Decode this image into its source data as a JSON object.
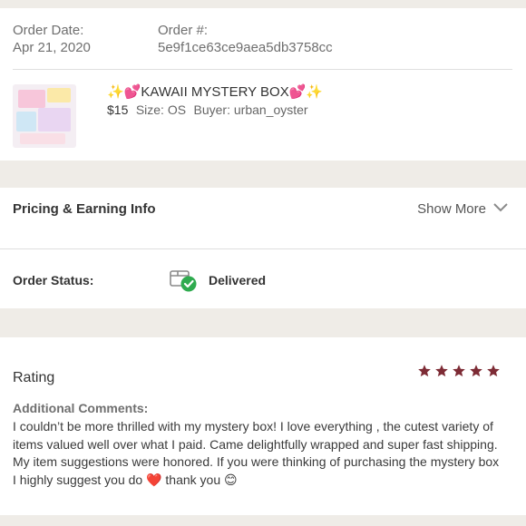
{
  "order": {
    "date_label": "Order Date:",
    "date_value": "Apr 21, 2020",
    "number_label": "Order #:",
    "number_value": "5e9f1ce63ce9aea5db3758cc"
  },
  "item": {
    "title_prefix": "✨💕",
    "title_text": "KAWAII MYSTERY BOX",
    "title_suffix": "💕✨",
    "price": "$15",
    "size": "Size: OS",
    "buyer": "Buyer: urban_oyster"
  },
  "pricing": {
    "title": "Pricing & Earning Info",
    "show_more": "Show More"
  },
  "status": {
    "label": "Order Status:",
    "value": "Delivered",
    "icon": "package-delivered-icon",
    "check_color": "#2fab4f"
  },
  "rating": {
    "title": "Rating",
    "stars": 5,
    "max_stars": 5,
    "star_color": "#7d2b35",
    "comments_label": "Additional Comments:",
    "comments_text": "I couldn’t be more thrilled with my mystery box! I love everything , the cutest variety of items valued well over what I paid. Came delightfully wrapped and super fast shipping. My item suggestions were honored. If you were thinking of purchasing the mystery box I highly suggest you do ❤️ thank you 😊"
  }
}
